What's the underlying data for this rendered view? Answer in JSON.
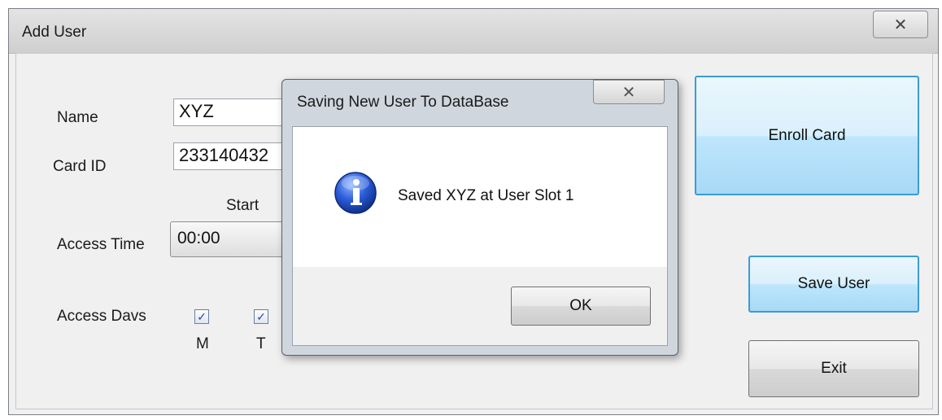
{
  "window": {
    "title": "Add User",
    "close_glyph": "✕"
  },
  "form": {
    "name_label": "Name",
    "name_value": "XYZ",
    "card_label": "Card ID",
    "card_value": "233140432",
    "start_label": "Start",
    "access_time_label": "Access Time",
    "start_time_value": "00:00",
    "access_days_label": "Access Davs",
    "days": [
      {
        "label": "M",
        "checked": true
      },
      {
        "label": "T",
        "checked": true
      }
    ]
  },
  "buttons": {
    "enroll": "Enroll Card",
    "save": "Save User",
    "exit": "Exit"
  },
  "dialog": {
    "title": "Saving New User To DataBase",
    "close_glyph": "✕",
    "icon": "info-icon",
    "message": "Saved XYZ at User Slot 1",
    "ok": "OK"
  }
}
